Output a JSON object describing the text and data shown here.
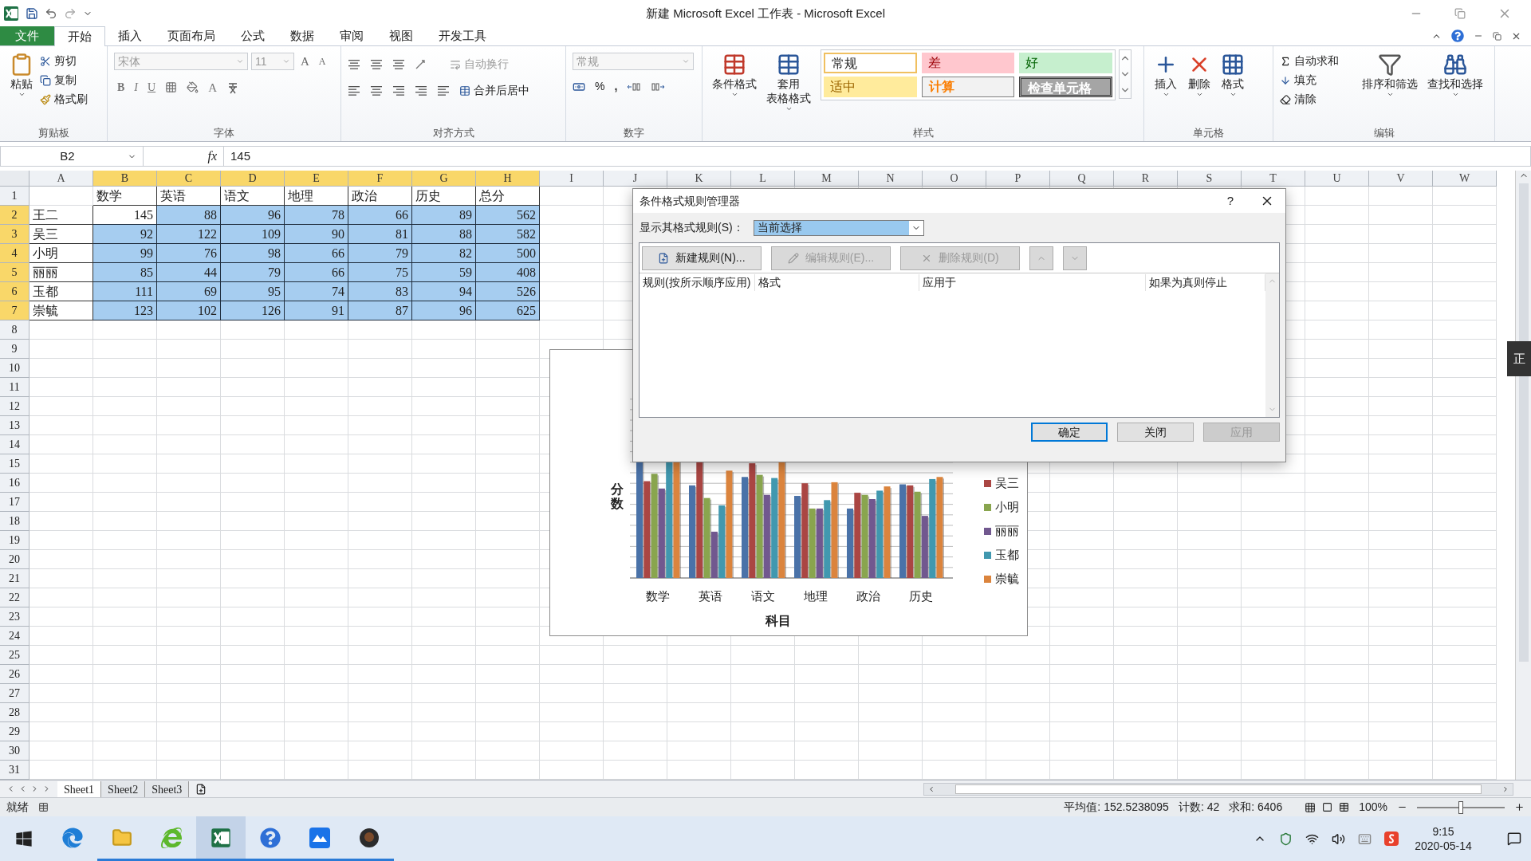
{
  "window": {
    "title": "新建 Microsoft Excel 工作表 - Microsoft Excel"
  },
  "ribbon_tabs": [
    {
      "label": "文件",
      "kind": "file",
      "selected": false
    },
    {
      "label": "开始",
      "kind": "tab",
      "selected": true
    },
    {
      "label": "插入",
      "kind": "tab",
      "selected": false
    },
    {
      "label": "页面布局",
      "kind": "tab",
      "selected": false
    },
    {
      "label": "公式",
      "kind": "tab",
      "selected": false
    },
    {
      "label": "数据",
      "kind": "tab",
      "selected": false
    },
    {
      "label": "审阅",
      "kind": "tab",
      "selected": false
    },
    {
      "label": "视图",
      "kind": "tab",
      "selected": false
    },
    {
      "label": "开发工具",
      "kind": "tab",
      "selected": false
    }
  ],
  "clipboard": {
    "label": "剪贴板",
    "paste": "粘贴",
    "cut": "剪切",
    "copy": "复制",
    "painter": "格式刷"
  },
  "font": {
    "label": "字体",
    "family": "宋体",
    "size": "11",
    "grow": "A",
    "shrink": "A",
    "bold": "B",
    "italic": "I",
    "underline": "U",
    "color_letter": "A"
  },
  "alignment": {
    "label": "对齐方式",
    "wrap": {
      "label": "自动换行",
      "disabled": true
    },
    "merge": {
      "label": "合并后居中",
      "disabled": false
    }
  },
  "number": {
    "label": "数字",
    "format": "常规",
    "percent": "%",
    "comma": ","
  },
  "styles": {
    "label": "样式",
    "conditional": "条件格式",
    "table_format": [
      "套用",
      "表格格式"
    ],
    "cells": [
      {
        "label": "常规",
        "kind": "normal"
      },
      {
        "label": "差",
        "kind": "bad"
      },
      {
        "label": "好",
        "kind": "good"
      },
      {
        "label": "适中",
        "kind": "neutral"
      },
      {
        "label": "计算",
        "kind": "calculation"
      },
      {
        "label": "检查单元格",
        "kind": "check"
      }
    ]
  },
  "cells_group": {
    "label": "单元格",
    "buttons": [
      "插入",
      "删除",
      "格式"
    ]
  },
  "editing": {
    "label": "编辑",
    "autosum": "自动求和",
    "fill": "填充",
    "clear": "清除",
    "sort": "排序和筛选",
    "find": "查找和选择"
  },
  "formula_bar": {
    "name_box": "B2",
    "fx": "fx",
    "value": "145"
  },
  "sheet": {
    "columns": [
      {
        "label": "A",
        "selected": false
      },
      {
        "label": "B",
        "selected": true
      },
      {
        "label": "C",
        "selected": true
      },
      {
        "label": "D",
        "selected": true
      },
      {
        "label": "E",
        "selected": true
      },
      {
        "label": "F",
        "selected": true
      },
      {
        "label": "G",
        "selected": true
      },
      {
        "label": "H",
        "selected": true
      },
      {
        "label": "I",
        "selected": false
      },
      {
        "label": "J",
        "selected": false
      },
      {
        "label": "K",
        "selected": false
      },
      {
        "label": "L",
        "selected": false
      },
      {
        "label": "M",
        "selected": false
      },
      {
        "label": "N",
        "selected": false
      },
      {
        "label": "O",
        "selected": false
      },
      {
        "label": "P",
        "selected": false
      },
      {
        "label": "Q",
        "selected": false
      },
      {
        "label": "R",
        "selected": false
      },
      {
        "label": "S",
        "selected": false
      },
      {
        "label": "T",
        "selected": false
      },
      {
        "label": "U",
        "selected": false
      },
      {
        "label": "V",
        "selected": false
      },
      {
        "label": "W",
        "selected": false
      }
    ],
    "row_headers": [
      {
        "label": "1",
        "selected": false
      },
      {
        "label": "2",
        "selected": true
      },
      {
        "label": "3",
        "selected": true
      },
      {
        "label": "4",
        "selected": true
      },
      {
        "label": "5",
        "selected": true
      },
      {
        "label": "6",
        "selected": true
      },
      {
        "label": "7",
        "selected": true
      },
      {
        "label": "8",
        "selected": false
      },
      {
        "label": "9",
        "selected": false
      },
      {
        "label": "10",
        "selected": false
      },
      {
        "label": "11",
        "selected": false
      },
      {
        "label": "12",
        "selected": false
      },
      {
        "label": "13",
        "selected": false
      },
      {
        "label": "14",
        "selected": false
      },
      {
        "label": "15",
        "selected": false
      },
      {
        "label": "16",
        "selected": false
      },
      {
        "label": "17",
        "selected": false
      },
      {
        "label": "18",
        "selected": false
      },
      {
        "label": "19",
        "selected": false
      },
      {
        "label": "20",
        "selected": false
      },
      {
        "label": "21",
        "selected": false
      },
      {
        "label": "22",
        "selected": false
      },
      {
        "label": "23",
        "selected": false
      },
      {
        "label": "24",
        "selected": false
      },
      {
        "label": "25",
        "selected": false
      },
      {
        "label": "26",
        "selected": false
      },
      {
        "label": "27",
        "selected": false
      },
      {
        "label": "28",
        "selected": false
      },
      {
        "label": "29",
        "selected": false
      },
      {
        "label": "30",
        "selected": false
      },
      {
        "label": "31",
        "selected": false
      }
    ],
    "header_cells": [
      "数学",
      "英语",
      "语文",
      "地理",
      "政治",
      "历史",
      "总分"
    ],
    "rows": [
      {
        "name": "王二",
        "cells": [
          {
            "text": "145",
            "selected": false
          },
          {
            "text": "88",
            "selected": true
          },
          {
            "text": "96",
            "selected": true
          },
          {
            "text": "78",
            "selected": true
          },
          {
            "text": "66",
            "selected": true
          },
          {
            "text": "89",
            "selected": true
          },
          {
            "text": "562",
            "selected": true
          }
        ]
      },
      {
        "name": "吴三",
        "cells": [
          {
            "text": "92",
            "selected": true
          },
          {
            "text": "122",
            "selected": true
          },
          {
            "text": "109",
            "selected": true
          },
          {
            "text": "90",
            "selected": true
          },
          {
            "text": "81",
            "selected": true
          },
          {
            "text": "88",
            "selected": true
          },
          {
            "text": "582",
            "selected": true
          }
        ]
      },
      {
        "name": "小明",
        "cells": [
          {
            "text": "99",
            "selected": true
          },
          {
            "text": "76",
            "selected": true
          },
          {
            "text": "98",
            "selected": true
          },
          {
            "text": "66",
            "selected": true
          },
          {
            "text": "79",
            "selected": true
          },
          {
            "text": "82",
            "selected": true
          },
          {
            "text": "500",
            "selected": true
          }
        ]
      },
      {
        "name": "丽丽",
        "cells": [
          {
            "text": "85",
            "selected": true
          },
          {
            "text": "44",
            "selected": true
          },
          {
            "text": "79",
            "selected": true
          },
          {
            "text": "66",
            "selected": true
          },
          {
            "text": "75",
            "selected": true
          },
          {
            "text": "59",
            "selected": true
          },
          {
            "text": "408",
            "selected": true
          }
        ]
      },
      {
        "name": "玉都",
        "cells": [
          {
            "text": "111",
            "selected": true
          },
          {
            "text": "69",
            "selected": true
          },
          {
            "text": "95",
            "selected": true
          },
          {
            "text": "74",
            "selected": true
          },
          {
            "text": "83",
            "selected": true
          },
          {
            "text": "94",
            "selected": true
          },
          {
            "text": "526",
            "selected": true
          }
        ]
      },
      {
        "name": "崇毓",
        "cells": [
          {
            "text": "123",
            "selected": true
          },
          {
            "text": "102",
            "selected": true
          },
          {
            "text": "126",
            "selected": true
          },
          {
            "text": "91",
            "selected": true
          },
          {
            "text": "87",
            "selected": true
          },
          {
            "text": "96",
            "selected": true
          },
          {
            "text": "625",
            "selected": true
          }
        ]
      }
    ]
  },
  "chart": {
    "y_title": "分数",
    "x_title": "科目",
    "categories": [
      "数学",
      "英语",
      "语文",
      "地理",
      "政治",
      "历史"
    ],
    "series": [
      {
        "color": "#4a72a8"
      },
      {
        "name": "吴三",
        "color": "#aa4643"
      },
      {
        "name": "小明",
        "color": "#89a54e"
      },
      {
        "name": "丽丽",
        "color": "#71588f"
      },
      {
        "name": "玉都",
        "color": "#4198af"
      },
      {
        "name": "崇毓",
        "color": "#db843d"
      }
    ]
  },
  "dialog": {
    "title": "条件格式规则管理器",
    "help": "?",
    "show_label": "显示其格式规则(S)：",
    "show_value": "当前选择",
    "tools": [
      {
        "label": "新建规则(N)...",
        "kind": "new",
        "disabled": false
      },
      {
        "label": "编辑规则(E)...",
        "kind": "edit",
        "disabled": true
      },
      {
        "label": "删除规则(D)",
        "kind": "delete",
        "disabled": true
      }
    ],
    "move_up_disabled": true,
    "move_down_disabled": true,
    "columns": [
      "规则(按所示顺序应用)",
      "格式",
      "应用于",
      "如果为真则停止"
    ],
    "buttons": [
      {
        "label": "确定",
        "selected": true,
        "disabled": false
      },
      {
        "label": "关闭",
        "selected": false,
        "disabled": false
      },
      {
        "label": "应用",
        "selected": false,
        "disabled": true
      }
    ]
  },
  "ime_tab": "正",
  "sheet_tabs": [
    {
      "label": "Sheet1",
      "selected": true
    },
    {
      "label": "Sheet2",
      "selected": false
    },
    {
      "label": "Sheet3",
      "selected": false
    }
  ],
  "status_bar": {
    "ready": "就绪",
    "stats": [
      "平均值: 152.5238095",
      "计数: 42",
      "求和: 6406"
    ],
    "zoom": {
      "label": "100%",
      "level": 0.5
    }
  },
  "taskbar": {
    "apps": [
      {
        "kind": "edge",
        "running": false,
        "selected": false
      },
      {
        "kind": "folder",
        "running": true,
        "selected": false
      },
      {
        "kind": "ie",
        "running": true,
        "selected": false
      },
      {
        "kind": "excel",
        "running": true,
        "selected": true
      },
      {
        "kind": "help",
        "running": true,
        "selected": false
      },
      {
        "kind": "cloud",
        "running": true,
        "selected": false
      },
      {
        "kind": "game",
        "running": true,
        "selected": false
      }
    ],
    "time": "9:15",
    "date": "2020-05-14"
  }
}
